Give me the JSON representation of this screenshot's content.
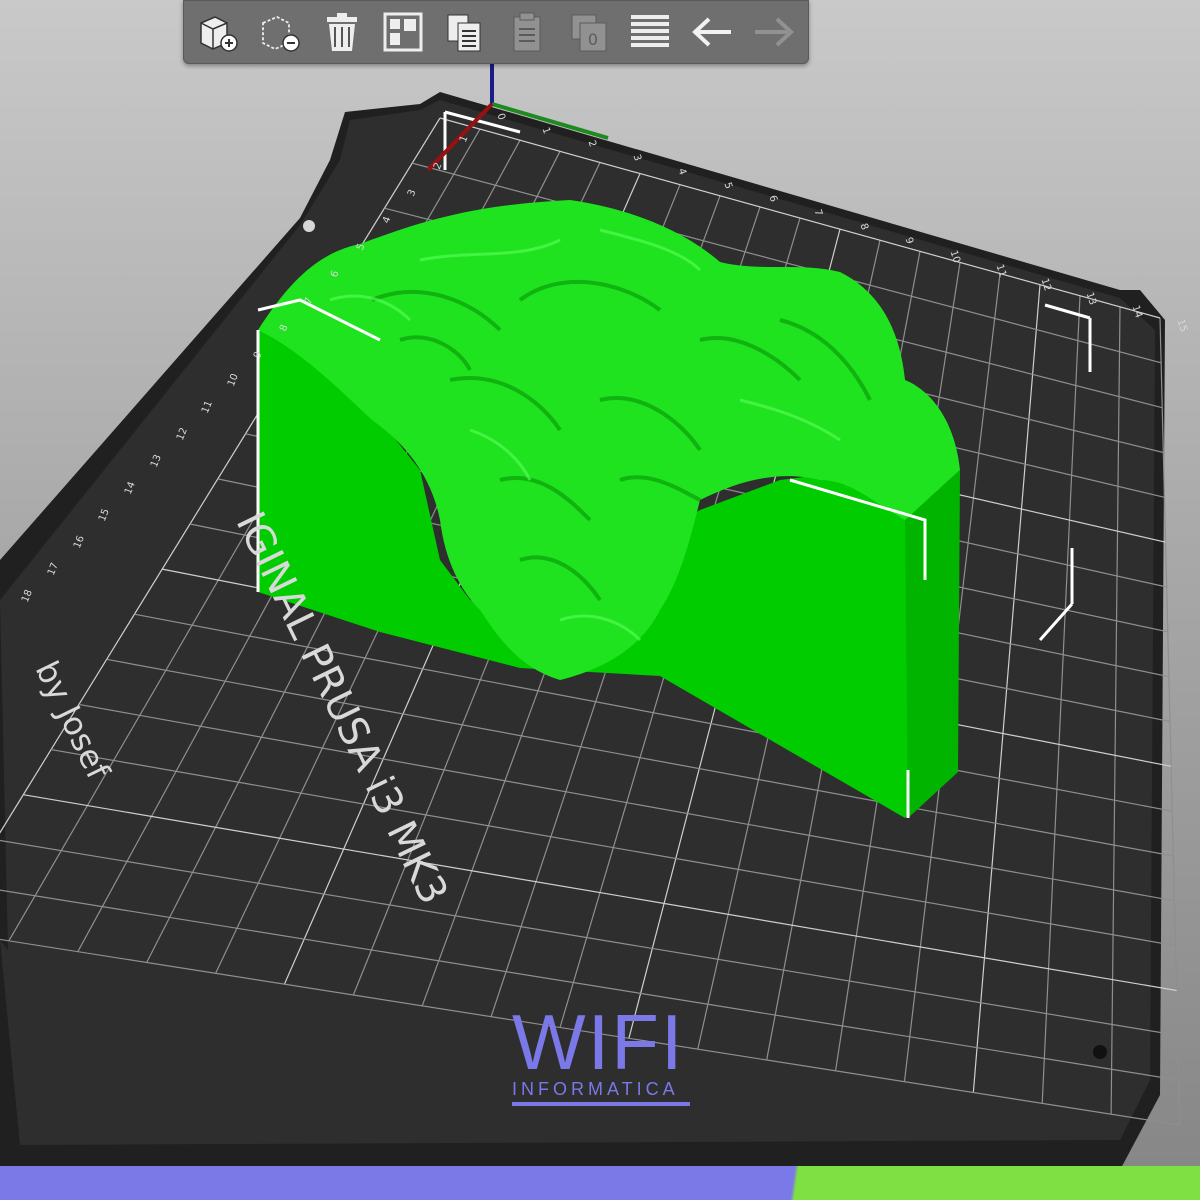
{
  "toolbar": {
    "buttons": [
      {
        "id": "add",
        "icon": "add-cube-icon",
        "enabled": true
      },
      {
        "id": "remove",
        "icon": "remove-cube-icon",
        "enabled": true
      },
      {
        "id": "delete-all",
        "icon": "trash-icon",
        "enabled": true
      },
      {
        "id": "arrange",
        "icon": "arrange-icon",
        "enabled": true
      },
      {
        "id": "copy",
        "icon": "copy-icon",
        "enabled": true
      },
      {
        "id": "paste",
        "icon": "paste-icon",
        "enabled": false
      },
      {
        "id": "instances",
        "icon": "instance-icon",
        "enabled": false
      },
      {
        "id": "layers",
        "icon": "layers-icon",
        "enabled": true
      },
      {
        "id": "undo",
        "icon": "undo-arrow-icon",
        "enabled": true
      },
      {
        "id": "redo",
        "icon": "redo-arrow-icon",
        "enabled": false
      }
    ]
  },
  "bed": {
    "logo_line1": "IGINAL PRUSA i3 MK3",
    "logo_line2": "by Josef",
    "ticks_top": [
      "0",
      "1",
      "2",
      "3",
      "4",
      "5",
      "6",
      "7",
      "8",
      "9",
      "10",
      "11",
      "12",
      "13",
      "14",
      "15"
    ],
    "ticks_left": [
      "1",
      "2",
      "3",
      "4",
      "5",
      "6",
      "7",
      "8",
      "9",
      "10",
      "11",
      "12",
      "13",
      "14",
      "15",
      "16",
      "17",
      "18"
    ],
    "colors": {
      "plate": "#2f2f2f",
      "grid": "#9a9a9a",
      "model": "#00e600",
      "model_side": "#00cc00"
    }
  },
  "brand": {
    "name": "WIFI",
    "subtitle": "INFORMATICA",
    "color": "#7b78e8"
  }
}
